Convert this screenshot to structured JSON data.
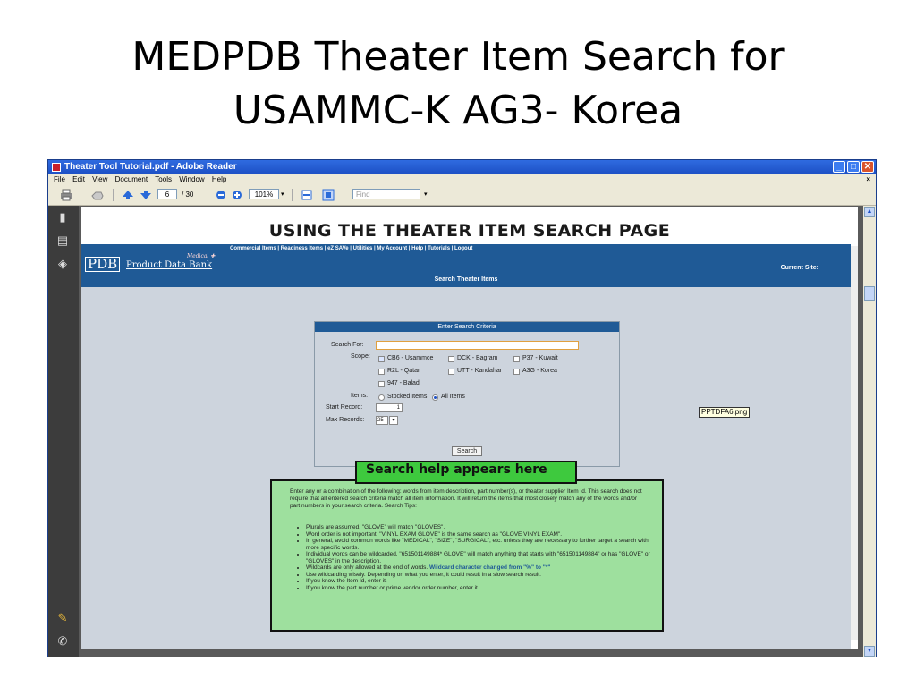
{
  "slide": {
    "title_line1": "MEDPDB Theater Item Search for",
    "title_line2": "USAMMC-K AG3- Korea"
  },
  "window": {
    "title": "Theater Tool Tutorial.pdf - Adobe Reader",
    "buttons": {
      "minimize": "_",
      "maximize": "□",
      "close": "✕"
    }
  },
  "menu": {
    "items": [
      "File",
      "Edit",
      "View",
      "Document",
      "Tools",
      "Window",
      "Help"
    ],
    "close_doc": "×"
  },
  "toolbar": {
    "page_current": "6",
    "page_total": "/ 30",
    "zoom": "101%",
    "find_placeholder": "Find"
  },
  "page": {
    "heading": "USING THE THEATER ITEM SEARCH PAGE",
    "nav_links": "Commercial Items | Readiness Items | eZ SAVe | Utilities | My Account | Help | Tutorials | Logout",
    "logo": {
      "box": "PDB",
      "text": "Product Data Bank",
      "medical": "Medical ✚"
    },
    "current_site": "Current Site:",
    "subheader": "Search Theater Items",
    "criteria": {
      "header": "Enter Search Criteria",
      "search_for_label": "Search For:",
      "search_for_value": "",
      "scope_label": "Scope:",
      "scope_options": [
        {
          "label": "CB6 - Usammce",
          "checked": true
        },
        {
          "label": "DCK - Bagram",
          "checked": false
        },
        {
          "label": "P37 - Kuwait",
          "checked": false
        },
        {
          "label": "R2L - Qatar",
          "checked": false
        },
        {
          "label": "UTT - Kandahar",
          "checked": false
        },
        {
          "label": "A3G - Korea",
          "checked": false
        },
        {
          "label": "947 - Balad",
          "checked": false
        }
      ],
      "items_label": "Items:",
      "items_options": [
        {
          "label": "Stocked Items",
          "selected": false
        },
        {
          "label": "All Items",
          "selected": true
        }
      ],
      "start_record_label": "Start Record:",
      "start_record_value": "1",
      "max_records_label": "Max Records:",
      "max_records_value": "25",
      "search_button": "Search"
    },
    "image_label": "PPTDFA6.png",
    "callout": "Search help appears here",
    "help": {
      "intro": "Enter any or a combination of the following: words from item description, part number(s), or theater supplier Item Id. This search does not require that all entered search criteria match all item information. It will return the items that most closely match any of the words and/or part numbers in your search criteria. Search Tips:",
      "tips": [
        "Plurals are assumed. \"GLOVE\" will match \"GLOVES\".",
        "Word order is not important. \"VINYL EXAM GLOVE\" is the same search as \"GLOVE VINYL EXAM\".",
        "In general, avoid common words like \"MEDICAL\", \"SIZE\", \"SURGICAL\", etc. unless they are necessary to further target a search with more specific words.",
        "Individual words can be wildcarded. \"651501149884* GLOVE\" will match anything that starts with \"651501149884\" or has \"GLOVE\" or \"GLOVES\" in the description.",
        "Use wildcarding wisely. Depending on what you enter, it could result in a slow search result.",
        "If you know the Item Id, enter it.",
        "If you know the part number or prime vendor order number, enter it."
      ],
      "wildcard_tip": "Wildcards are only allowed at the end of words.",
      "wildcard_note": "Wildcard character changed from \"%\" to \"*\""
    }
  }
}
